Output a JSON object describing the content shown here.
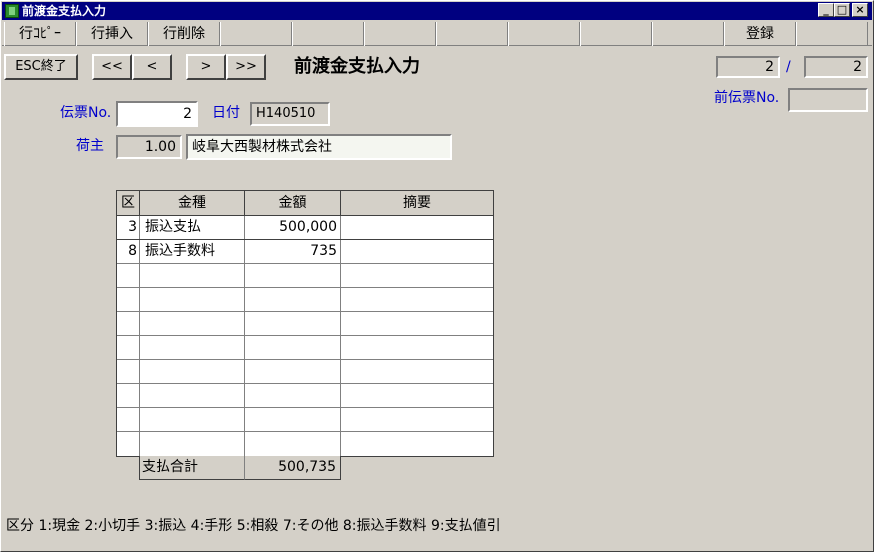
{
  "window": {
    "title": "前渡金支払入力",
    "min_label": "_",
    "max_label": "□",
    "close_label": "×"
  },
  "menu": {
    "items": [
      "行ｺﾋﾟｰ",
      "行挿入",
      "行削除",
      "",
      "",
      "",
      "",
      "",
      "",
      "",
      "登録",
      ""
    ]
  },
  "toolbar": {
    "esc_label": "ESC終了",
    "first_label": "<<",
    "prev_label": "<",
    "next_label": ">",
    "last_label": ">>",
    "heading": "前渡金支払入力",
    "page_current": "2",
    "page_sep": "/",
    "page_total": "2"
  },
  "form": {
    "prev_slip_label": "前伝票No.",
    "prev_slip_value": "",
    "slip_label": "伝票No.",
    "slip_value": "2",
    "date_label": "日付",
    "date_value": "H140510",
    "shipper_label": "荷主",
    "shipper_code": "1.00",
    "shipper_name": "岐阜大西製材株式会社"
  },
  "grid": {
    "headers": [
      "区",
      "金種",
      "金額",
      "摘要"
    ],
    "rows": [
      [
        "3",
        "振込支払",
        "500,000",
        ""
      ],
      [
        "8",
        "振込手数料",
        "735",
        ""
      ]
    ],
    "total_label": "支払合計",
    "total_value": "500,735"
  },
  "footer": {
    "legend": "区分 1:現金 2:小切手 3:振込 4:手形 5:相殺 7:その他 8:振込手数料 9:支払値引"
  }
}
